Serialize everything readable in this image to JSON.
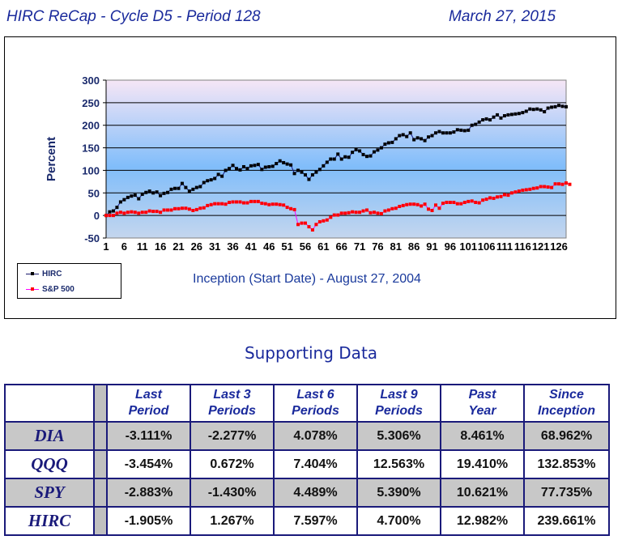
{
  "header": {
    "title": "HIRC ReCap - Cycle D5 - Period 128",
    "date": "March 27, 2015"
  },
  "chart_data": {
    "type": "line",
    "title": "",
    "xlabel": "",
    "ylabel": "Percent",
    "ylim": [
      -50,
      300
    ],
    "yticks": [
      -50,
      0,
      50,
      100,
      150,
      200,
      250,
      300
    ],
    "xlim": [
      1,
      128
    ],
    "xticks": [
      1,
      6,
      11,
      16,
      21,
      26,
      31,
      36,
      41,
      46,
      51,
      56,
      61,
      66,
      71,
      76,
      81,
      86,
      91,
      96,
      101,
      106,
      111,
      116,
      121,
      126
    ],
    "grid": true,
    "legend_position": "bottom-left",
    "annotation": "Inception (Start Date) - August 27, 2004",
    "series": [
      {
        "name": "HIRC",
        "color": "#000000",
        "line_color": "#1a1a8c",
        "values": [
          0,
          8,
          10,
          18,
          30,
          35,
          40,
          43,
          45,
          37,
          47,
          51,
          54,
          50,
          52,
          44,
          49,
          51,
          58,
          60,
          60,
          71,
          62,
          54,
          58,
          62,
          64,
          73,
          77,
          79,
          82,
          91,
          87,
          100,
          104,
          111,
          104,
          101,
          108,
          104,
          110,
          111,
          113,
          102,
          107,
          108,
          109,
          115,
          121,
          117,
          114,
          112,
          93,
          100,
          96,
          90,
          80,
          90,
          96,
          102,
          110,
          118,
          125,
          125,
          136,
          125,
          130,
          129,
          140,
          146,
          143,
          135,
          131,
          132,
          141,
          145,
          150,
          158,
          161,
          162,
          170,
          177,
          179,
          175,
          183,
          168,
          172,
          170,
          166,
          174,
          177,
          183,
          186,
          183,
          183,
          183,
          185,
          190,
          189,
          188,
          189,
          200,
          202,
          207,
          212,
          214,
          212,
          218,
          223,
          216,
          221,
          223,
          224,
          225,
          226,
          228,
          231,
          236,
          235,
          236,
          234,
          230,
          238,
          240,
          241,
          244,
          242,
          241
        ],
        "ylim_note": ""
      },
      {
        "name": "S&P 500",
        "color": "#ff0000",
        "line_color": "#ff00ff",
        "values": [
          0,
          0,
          0,
          5,
          7,
          5,
          7,
          8,
          7,
          5,
          7,
          7,
          10,
          9,
          9,
          7,
          12,
          12,
          12,
          15,
          15,
          16,
          16,
          14,
          11,
          13,
          16,
          17,
          22,
          24,
          26,
          26,
          26,
          25,
          29,
          30,
          30,
          30,
          28,
          28,
          31,
          31,
          31,
          27,
          26,
          24,
          25,
          25,
          24,
          23,
          18,
          15,
          13,
          -20,
          -17,
          -17,
          -25,
          -32,
          -20,
          -14,
          -12,
          -10,
          -4,
          1,
          1,
          5,
          5,
          6,
          8,
          7,
          7,
          10,
          12,
          6,
          7,
          5,
          4,
          10,
          12,
          15,
          16,
          20,
          22,
          24,
          25,
          25,
          24,
          21,
          25,
          14,
          11,
          23,
          16,
          27,
          29,
          29,
          29,
          26,
          26,
          29,
          31,
          32,
          29,
          28,
          34,
          36,
          39,
          38,
          41,
          42,
          46,
          45,
          50,
          52,
          54,
          56,
          57,
          58,
          60,
          61,
          64,
          64,
          63,
          62,
          70,
          70,
          69,
          72,
          69
        ],
        "ylim_note": ""
      }
    ]
  },
  "legend": {
    "items": [
      "HIRC",
      "S&P 500"
    ]
  },
  "supporting": {
    "title": "Supporting Data",
    "columns": [
      [
        "Last",
        "Period"
      ],
      [
        "Last 3",
        "Periods"
      ],
      [
        "Last 6",
        "Periods"
      ],
      [
        "Last 9",
        "Periods"
      ],
      [
        "Past",
        "Year"
      ],
      [
        "Since",
        "Inception"
      ]
    ],
    "rows": [
      {
        "label": "DIA",
        "values": [
          "-3.111%",
          "-2.277%",
          "4.078%",
          "5.306%",
          "8.461%",
          "68.962%"
        ]
      },
      {
        "label": "QQQ",
        "values": [
          "-3.454%",
          "0.672%",
          "7.404%",
          "12.563%",
          "19.410%",
          "132.853%"
        ]
      },
      {
        "label": "SPY",
        "values": [
          "-2.883%",
          "-1.430%",
          "4.489%",
          "5.390%",
          "10.621%",
          "77.735%"
        ]
      },
      {
        "label": "HIRC",
        "values": [
          "-1.905%",
          "1.267%",
          "7.597%",
          "4.700%",
          "12.982%",
          "239.661%"
        ]
      }
    ]
  }
}
